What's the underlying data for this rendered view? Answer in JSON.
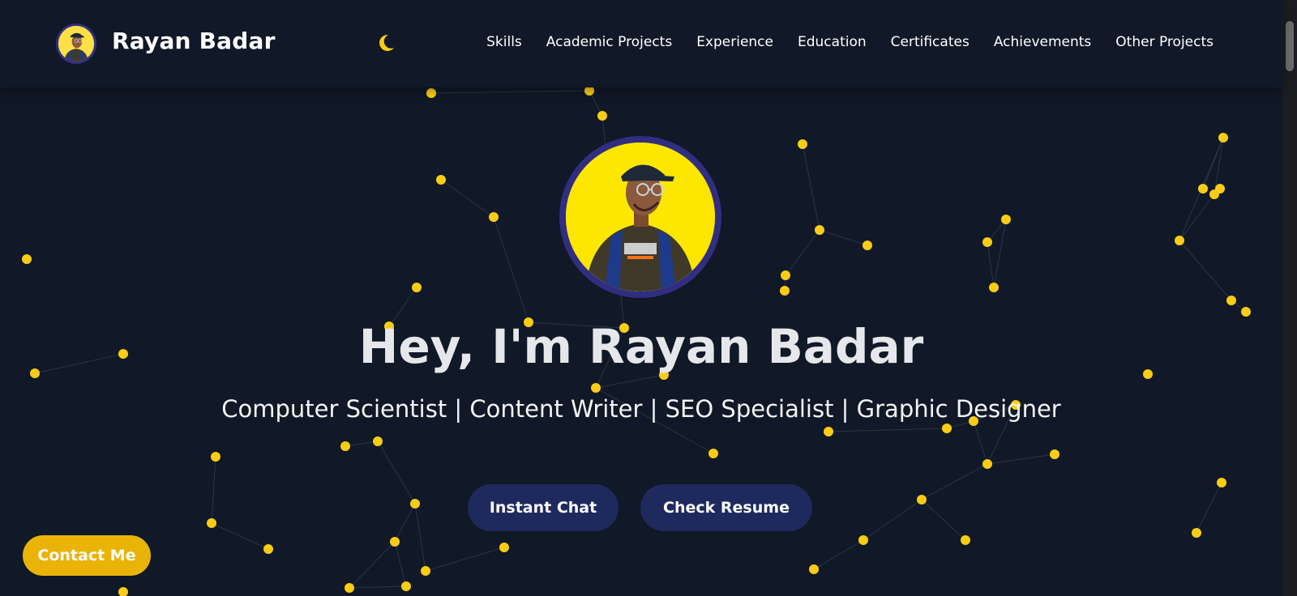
{
  "colors": {
    "background": "#111827",
    "particle": "#facc15",
    "particle_link": "#334155",
    "button_bg": "#1e2a5e",
    "contact_bg": "#eab308",
    "avatar_bg": "#fde700",
    "avatar_ring": "#312e81"
  },
  "navbar": {
    "brand_name": "Rayan Badar",
    "theme_icon": "moon-icon",
    "links": [
      "Skills",
      "Academic Projects",
      "Experience",
      "Education",
      "Certificates",
      "Achievements",
      "Other Projects"
    ]
  },
  "hero": {
    "avatar_icon": "profile-photo",
    "title": "Hey, I'm Rayan Badar",
    "subtitle": "Computer Scientist | Content Writer | SEO Specialist | Graphic Designer",
    "buttons": {
      "chat": "Instant Chat",
      "resume": "Check Resume"
    }
  },
  "contact_button": "Contact Me"
}
